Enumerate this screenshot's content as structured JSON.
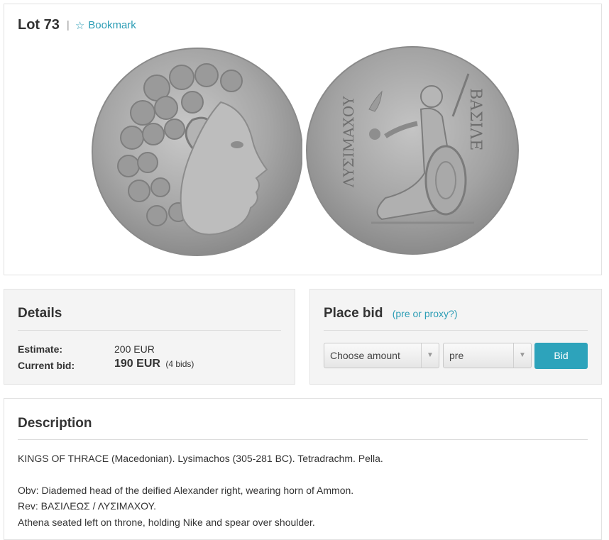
{
  "lot": {
    "title": "Lot 73",
    "separator": "|",
    "bookmark_label": "Bookmark",
    "bookmark_icon": "star-outline-icon"
  },
  "images": {
    "obverse": "coin-obverse-head-of-alexander",
    "reverse": "coin-reverse-seated-athena"
  },
  "details": {
    "title": "Details",
    "estimate_label": "Estimate:",
    "estimate_value": "200 EUR",
    "current_bid_label": "Current bid:",
    "current_bid_value": "190 EUR",
    "bids_count": "(4 bids)"
  },
  "place_bid": {
    "title": "Place bid",
    "proxy_link": "(pre or proxy?)",
    "amount_select": "Choose amount",
    "mode_select": "pre",
    "bid_button": "Bid"
  },
  "description": {
    "title": "Description",
    "line1": "KINGS OF THRACE (Macedonian). Lysimachos (305-281 BC). Tetradrachm. Pella.",
    "line2": "Obv: Diademed head of the deified Alexander right, wearing horn of Ammon.",
    "line3": "Rev: ΒΑΣΙΛΕΩΣ / ΛΥΣΙΜΑΧΟΥ.",
    "line4": "Athena seated left on throne, holding Nike and spear over shoulder."
  },
  "colors": {
    "accent": "#2c9db5",
    "button": "#2da3bb",
    "panel_bg": "#f4f4f4"
  }
}
